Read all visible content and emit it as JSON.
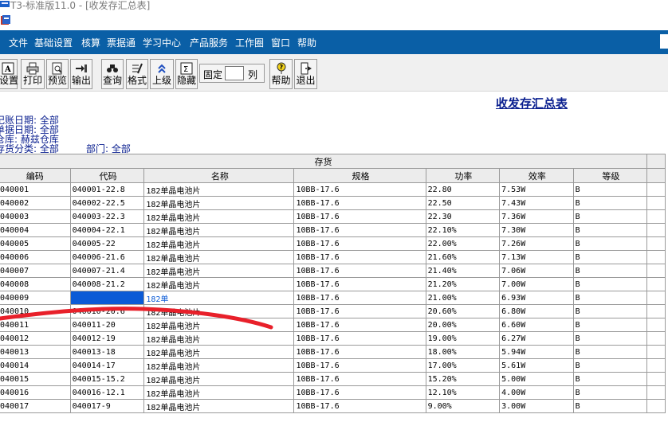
{
  "window": {
    "title": "T3-标准版11.0 - [收发存汇总表]"
  },
  "menu": {
    "items": [
      "文件",
      "基础设置",
      "核算",
      "票据通",
      "学习中心",
      "产品服务",
      "工作圈",
      "窗口",
      "帮助"
    ]
  },
  "toolbar": {
    "buttons": [
      "设置",
      "打印",
      "预览",
      "输出",
      "查询",
      "格式",
      "上级",
      "隐藏"
    ],
    "fixed_label": "固定",
    "fixed_value": "",
    "fixed_unit": "列",
    "help": "帮助",
    "exit": "退出"
  },
  "report": {
    "title": "收发存汇总表",
    "filters": [
      "记账日期: 全部",
      "单据日期: 全部",
      "仓库: 赫兹仓库",
      "存货分类: 全部"
    ],
    "dept": "部门: 全部"
  },
  "table": {
    "group_header": "存货",
    "columns": [
      "编码",
      "代码",
      "名称",
      "规格",
      "功率",
      "效率",
      "等级"
    ],
    "rows": [
      [
        "040001",
        "040001-22.8",
        "182单晶电池片",
        "10BB-17.6",
        "22.80",
        "7.53W",
        "B"
      ],
      [
        "040002",
        "040002-22.5",
        "182单晶电池片",
        "10BB-17.6",
        "22.50",
        "7.43W",
        "B"
      ],
      [
        "040003",
        "040003-22.3",
        "182单晶电池片",
        "10BB-17.6",
        "22.30",
        "7.36W",
        "B"
      ],
      [
        "040004",
        "040004-22.1",
        "182单晶电池片",
        "10BB-17.6",
        "22.10%",
        "7.30W",
        "B"
      ],
      [
        "040005",
        "040005-22",
        "182单晶电池片",
        "10BB-17.6",
        "22.00%",
        "7.26W",
        "B"
      ],
      [
        "040006",
        "040006-21.6",
        "182单晶电池片",
        "10BB-17.6",
        "21.60%",
        "7.13W",
        "B"
      ],
      [
        "040007",
        "040007-21.4",
        "182单晶电池片",
        "10BB-17.6",
        "21.40%",
        "7.06W",
        "B"
      ],
      [
        "040008",
        "040008-21.2",
        "182单晶电池片",
        "10BB-17.6",
        "21.20%",
        "7.00W",
        "B"
      ],
      [
        "040009",
        "",
        "182单",
        "10BB-17.6",
        "21.00%",
        "6.93W",
        "B"
      ],
      [
        "040010",
        "040010-20.6",
        "182单晶电池片",
        "10BB-17.6",
        "20.60%",
        "6.80W",
        "B"
      ],
      [
        "040011",
        "040011-20",
        "182单晶电池片",
        "10BB-17.6",
        "20.00%",
        "6.60W",
        "B"
      ],
      [
        "040012",
        "040012-19",
        "182单晶电池片",
        "10BB-17.6",
        "19.00%",
        "6.27W",
        "B"
      ],
      [
        "040013",
        "040013-18",
        "182单晶电池片",
        "10BB-17.6",
        "18.00%",
        "5.94W",
        "B"
      ],
      [
        "040014",
        "040014-17",
        "182单晶电池片",
        "10BB-17.6",
        "17.00%",
        "5.61W",
        "B"
      ],
      [
        "040015",
        "040015-15.2",
        "182单晶电池片",
        "10BB-17.6",
        "15.20%",
        "5.00W",
        "B"
      ],
      [
        "040016",
        "040016-12.1",
        "182单晶电池片",
        "10BB-17.6",
        "12.10%",
        "4.00W",
        "B"
      ],
      [
        "040017",
        "040017-9",
        "182单晶电池片",
        "10BB-17.6",
        "9.00%",
        "3.00W",
        "B"
      ]
    ]
  },
  "colors": {
    "menubar": "#0a5fa6",
    "title_text": "#0a1f8f",
    "selection": "#0a5ad6",
    "red_mark": "#e8202a"
  }
}
